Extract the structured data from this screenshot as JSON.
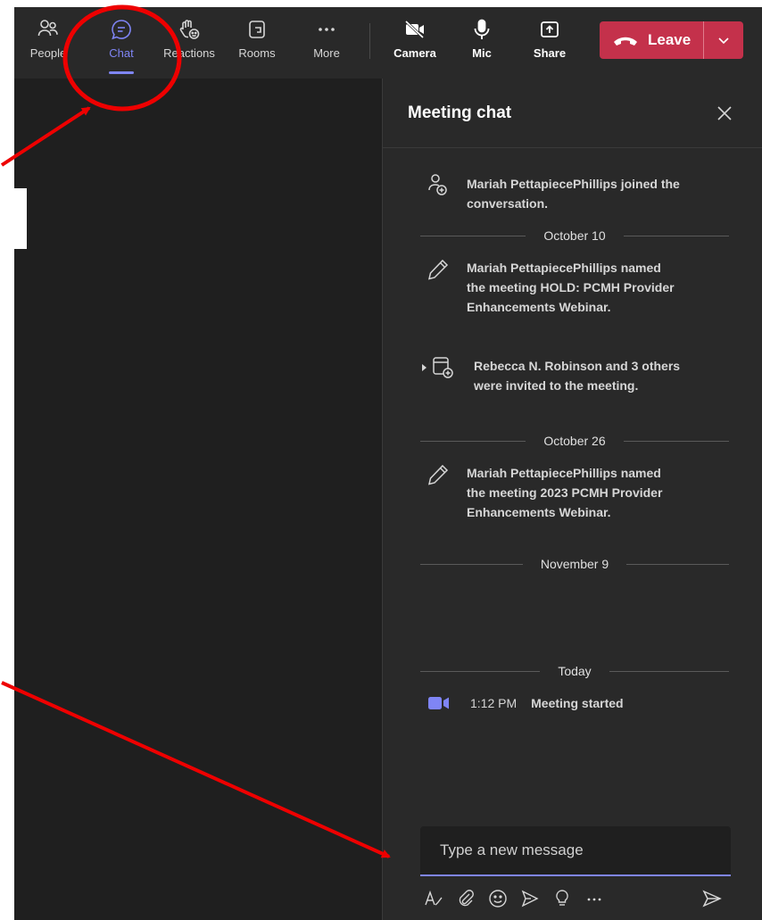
{
  "toolbar": {
    "items": [
      {
        "label": "People",
        "icon": "people-icon"
      },
      {
        "label": "Chat",
        "icon": "chat-icon",
        "active": true
      },
      {
        "label": "Reactions",
        "icon": "raise-hand-icon"
      },
      {
        "label": "Rooms",
        "icon": "rooms-icon"
      },
      {
        "label": "More",
        "icon": "more-icon"
      }
    ],
    "controls": [
      {
        "label": "Camera",
        "icon": "camera-off-icon"
      },
      {
        "label": "Mic",
        "icon": "mic-icon"
      },
      {
        "label": "Share",
        "icon": "share-icon"
      }
    ],
    "leave_label": "Leave",
    "leave_color": "#c4314b",
    "accent_color": "#7f85f5"
  },
  "chat": {
    "title": "Meeting chat",
    "events": [
      {
        "icon": "person-join-icon",
        "text": "Mariah PettapiecePhillips joined the conversation."
      },
      {
        "icon": "pencil-icon",
        "text": "Mariah PettapiecePhillips named the meeting HOLD: PCMH Provider Enhancements Webinar."
      },
      {
        "icon": "calendar-invite-icon",
        "text": "Rebecca N. Robinson and 3 others were invited to the meeting."
      },
      {
        "icon": "pencil-icon",
        "text": "Mariah PettapiecePhillips named the meeting 2023 PCMH Provider Enhancements Webinar."
      }
    ],
    "dates": [
      "October 10",
      "October 26",
      "November 9",
      "Today"
    ],
    "meeting_started": {
      "time": "1:12 PM",
      "text": "Meeting started"
    },
    "composer_placeholder": "Type a new message"
  }
}
